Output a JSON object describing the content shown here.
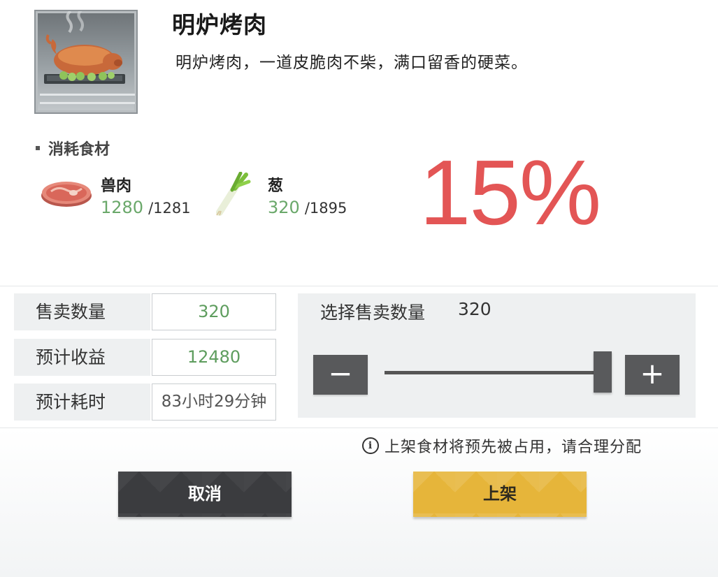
{
  "dish": {
    "title": "明炉烤肉",
    "description": "明炉烤肉，一道皮脆肉不柴，满口留香的硬菜。",
    "image_icon": "roast-pig-icon"
  },
  "ingredients": {
    "section_label": "消耗食材",
    "items": [
      {
        "icon": "meat-steak-icon",
        "name": "兽肉",
        "used": "1280",
        "owned": "/1281"
      },
      {
        "icon": "scallion-icon",
        "name": "葱",
        "used": "320",
        "owned": "/1895"
      }
    ]
  },
  "percent": "15%",
  "sale": {
    "quantity_label": "售卖数量",
    "quantity_value": "320",
    "income_label": "预计收益",
    "income_value": "12480",
    "time_label": "预计耗时",
    "time_value": "83小时29分钟"
  },
  "slider": {
    "title": "选择售卖数量",
    "readout": "320",
    "minus_label": "−",
    "plus_label": "+",
    "level_fraction": 1.0
  },
  "notice": {
    "icon": "info-icon",
    "icon_glyph": "i",
    "text": "上架食材将预先被占用，请合理分配"
  },
  "buttons": {
    "cancel_label": "取消",
    "confirm_label": "上架"
  },
  "colors": {
    "percent": "#e35555",
    "count_green": "#6aa86a",
    "cancel_bg": "#3b3c3f",
    "confirm_bg": "#e6b53a"
  }
}
